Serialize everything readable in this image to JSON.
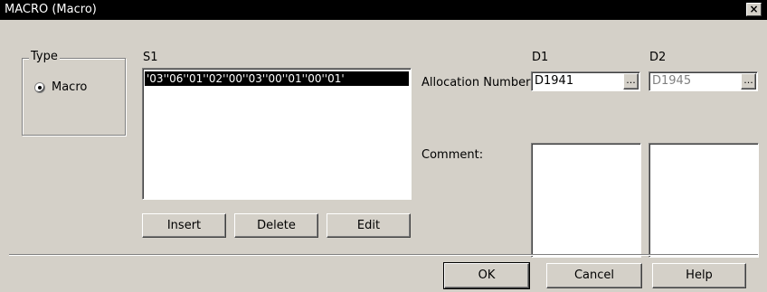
{
  "window": {
    "title": "MACRO (Macro)",
    "close_glyph": "×"
  },
  "type_group": {
    "legend": "Type",
    "radio_label": "Macro",
    "selected": true
  },
  "s1": {
    "label": "S1",
    "items": [
      "'03''06''01''02''00''03''00''01''00''01'"
    ],
    "buttons": {
      "insert": "Insert",
      "delete": "Delete",
      "edit": "Edit"
    }
  },
  "allocation": {
    "label": "Allocation Number:",
    "d1": {
      "header": "D1",
      "value": "D1941",
      "browse": "..."
    },
    "d2": {
      "header": "D2",
      "value": "D1945",
      "browse": "..."
    }
  },
  "comment": {
    "label": "Comment:"
  },
  "footer": {
    "ok": "OK",
    "cancel": "Cancel",
    "help": "Help"
  }
}
